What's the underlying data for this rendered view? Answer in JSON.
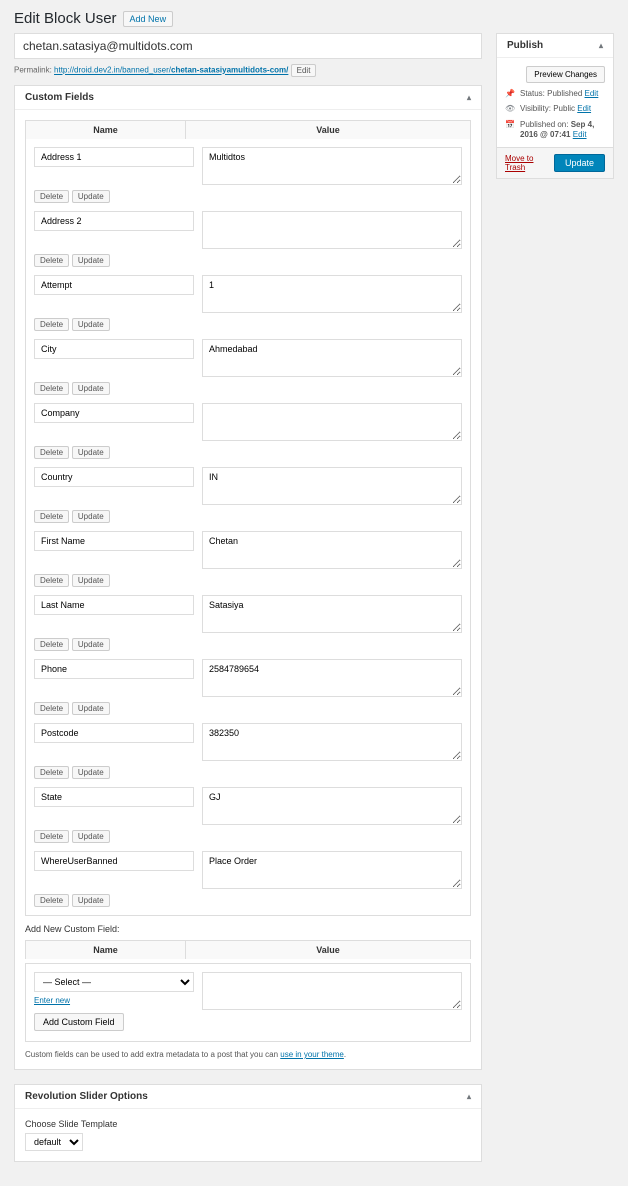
{
  "heading": {
    "title": "Edit Block User",
    "add_new": "Add New"
  },
  "post_title": "chetan.satasiya@multidots.com",
  "permalink": {
    "label": "Permalink:",
    "base": "http://droid.dev2.in/banned_user/",
    "slug": "chetan-satasiyamultidots-com/",
    "edit": "Edit"
  },
  "custom_fields": {
    "box_title": "Custom Fields",
    "name_header": "Name",
    "value_header": "Value",
    "delete_label": "Delete",
    "update_label": "Update",
    "rows": [
      {
        "name": "Address 1",
        "value": "Multidtos"
      },
      {
        "name": "Address 2",
        "value": ""
      },
      {
        "name": "Attempt",
        "value": "1"
      },
      {
        "name": "City",
        "value": "Ahmedabad"
      },
      {
        "name": "Company",
        "value": ""
      },
      {
        "name": "Country",
        "value": "IN"
      },
      {
        "name": "First Name",
        "value": "Chetan"
      },
      {
        "name": "Last Name",
        "value": "Satasiya"
      },
      {
        "name": "Phone",
        "value": "2584789654"
      },
      {
        "name": "Postcode",
        "value": "382350"
      },
      {
        "name": "State",
        "value": "GJ"
      },
      {
        "name": "WhereUserBanned",
        "value": "Place Order"
      }
    ],
    "add_new_label": "Add New Custom Field:",
    "select_placeholder": "— Select —",
    "enter_new": "Enter new",
    "add_button": "Add Custom Field",
    "helper_text": "Custom fields can be used to add extra metadata to a post that you can ",
    "helper_link": "use in your theme"
  },
  "rev_slider": {
    "box_title": "Revolution Slider Options",
    "label": "Choose Slide Template",
    "selected": "default"
  },
  "publish": {
    "box_title": "Publish",
    "preview": "Preview Changes",
    "status_label": "Status:",
    "status_value": "Published",
    "visibility_label": "Visibility:",
    "visibility_value": "Public",
    "published_label": "Published on:",
    "published_value": "Sep 4, 2016 @ 07:41",
    "edit": "Edit",
    "trash": "Move to Trash",
    "update": "Update"
  }
}
